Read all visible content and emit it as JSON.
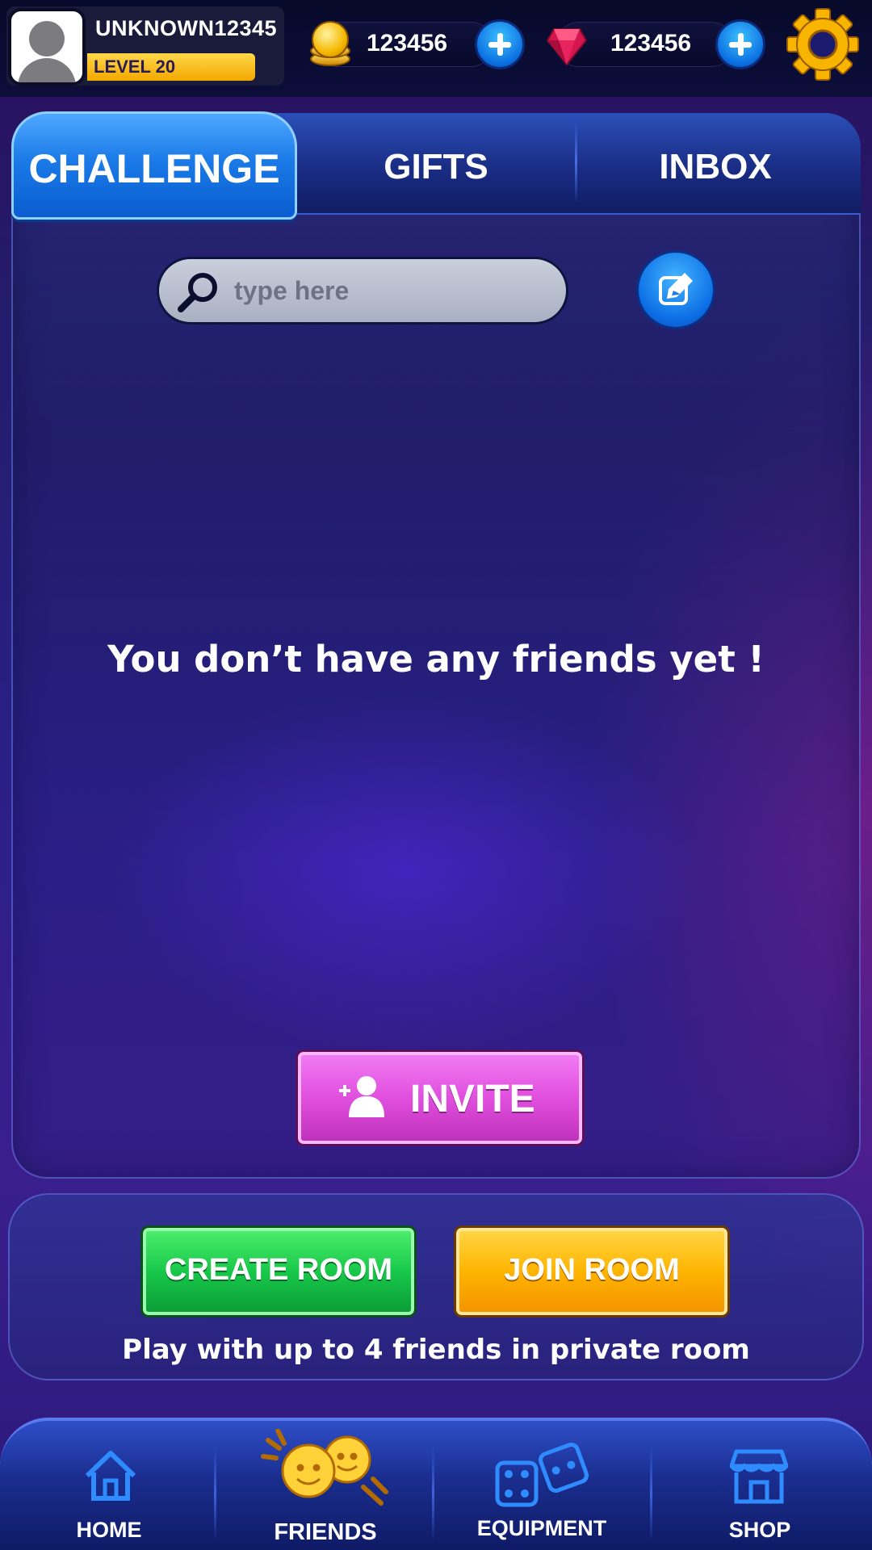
{
  "profile": {
    "username": "UNKNOWN12345",
    "level": "LEVEL 20"
  },
  "currency": {
    "coins": "123456",
    "gems": "123456"
  },
  "tabs": [
    {
      "label": "CHALLENGE",
      "active": true
    },
    {
      "label": "GIFTS",
      "active": false
    },
    {
      "label": "INBOX",
      "active": false
    }
  ],
  "search": {
    "placeholder": "type here",
    "value": ""
  },
  "empty_message": "You don’t have any friends yet !",
  "invite_label": "INVITE",
  "room": {
    "create_label": "CREATE ROOM",
    "join_label": "JOIN ROOM",
    "caption": "Play with up to 4 friends in private room"
  },
  "nav": [
    {
      "label": "HOME",
      "icon": "house-icon"
    },
    {
      "label": "FRIENDS",
      "icon": "friends-icon"
    },
    {
      "label": "EQUIPMENT",
      "icon": "dice-icon"
    },
    {
      "label": "SHOP",
      "icon": "shop-icon"
    }
  ],
  "colors": {
    "accent_blue": "#1b7ae8",
    "invite_pink": "#e04fde",
    "create_green": "#18c84a",
    "join_yellow": "#ffb400",
    "level_yellow": "#ffd84a"
  }
}
